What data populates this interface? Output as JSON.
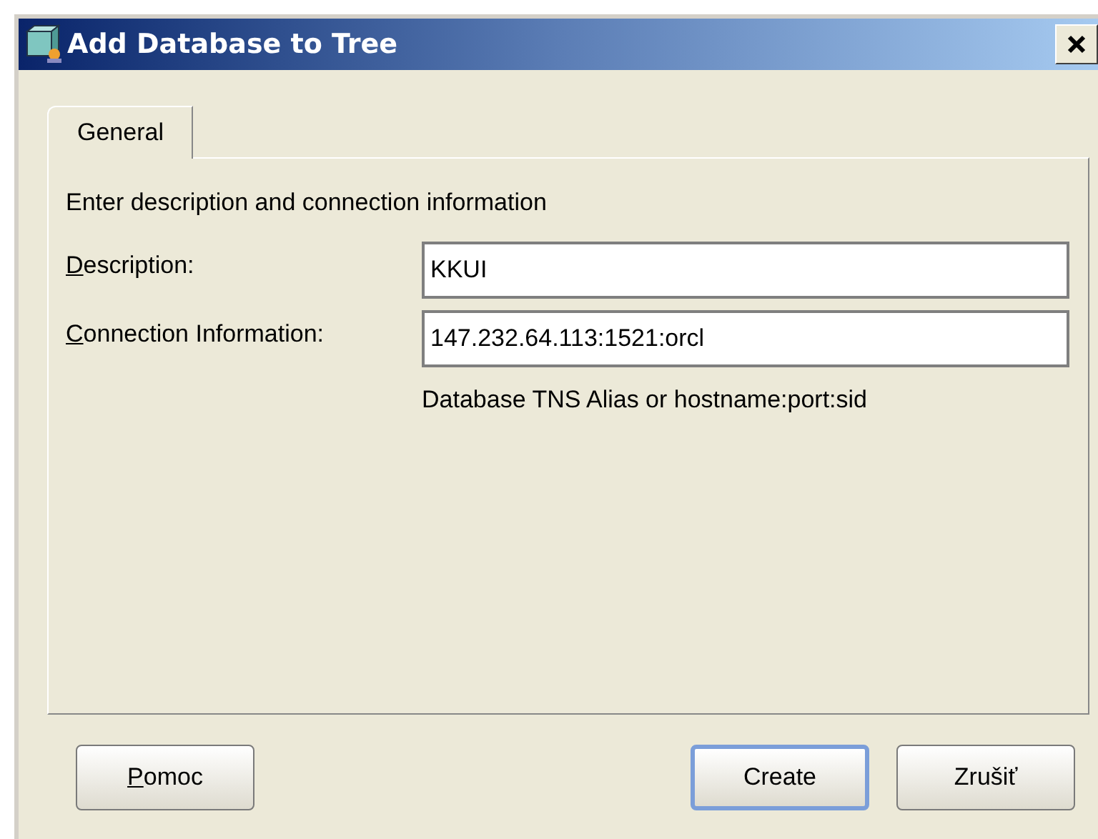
{
  "window": {
    "title": "Add Database to Tree"
  },
  "tabs": [
    {
      "label": "General",
      "selected": true
    }
  ],
  "panel": {
    "intro": "Enter description and connection information",
    "fields": [
      {
        "mnemonic": "D",
        "label_rest": "escription:",
        "value": "KKUI"
      },
      {
        "mnemonic": "C",
        "label_rest": "onnection Information:",
        "value": "147.232.64.113:1521:orcl"
      }
    ],
    "hint": "Database TNS Alias or hostname:port:sid"
  },
  "buttons": [
    {
      "mnemonic": "P",
      "label_rest": "omoc",
      "default": false
    },
    {
      "label_rest": "Create",
      "default": true
    },
    {
      "label_rest": "Zrušiť",
      "default": false
    }
  ]
}
